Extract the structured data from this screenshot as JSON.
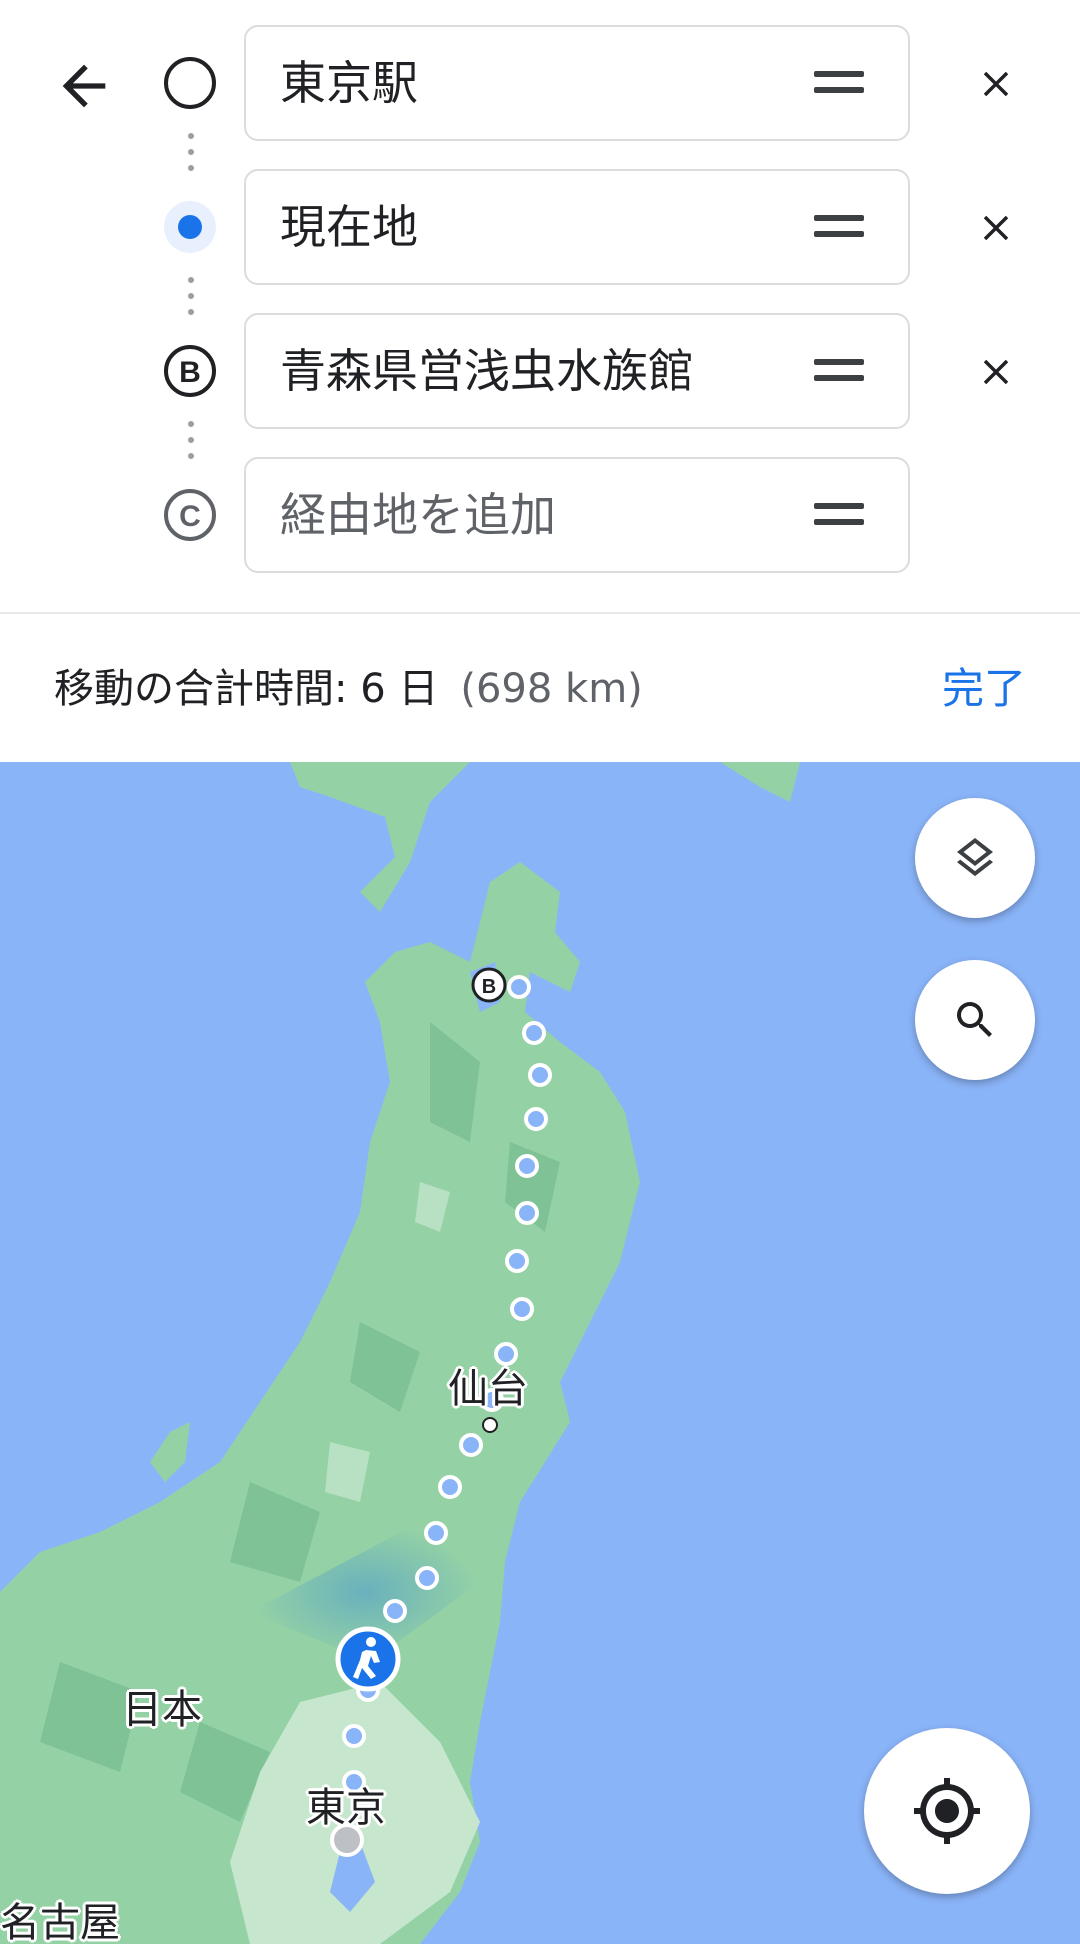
{
  "directions": {
    "back_icon": "arrow-back-icon",
    "waypoints": [
      {
        "marker": "origin-circle-icon",
        "text": "東京駅",
        "is_placeholder": false,
        "removable": true
      },
      {
        "marker": "current-location-dot-icon",
        "text": "現在地",
        "is_placeholder": false,
        "removable": true
      },
      {
        "marker": "letter-marker-icon",
        "marker_letter": "B",
        "text": "青森県営浅虫水族館",
        "is_placeholder": false,
        "removable": true
      },
      {
        "marker": "letter-marker-icon",
        "marker_letter": "C",
        "text": "経由地を追加",
        "is_placeholder": true,
        "removable": false
      }
    ]
  },
  "summary": {
    "total_time": "移動の合計時間: 6 日",
    "distance": "(698 km)",
    "done_label": "完了"
  },
  "map": {
    "route_mode": "walking",
    "labels": {
      "sendai": "仙台",
      "japan": "日本",
      "tokyo": "東京",
      "nagoya": "名古屋"
    },
    "destination_marker_letter": "B",
    "controls": {
      "layers": "layers-icon",
      "search": "search-icon",
      "my_location": "my-location-icon"
    },
    "colors": {
      "water": "#8ab4f8",
      "land": "#94d2a5",
      "route": "#8ab4f8",
      "accent": "#1a73e8"
    }
  }
}
